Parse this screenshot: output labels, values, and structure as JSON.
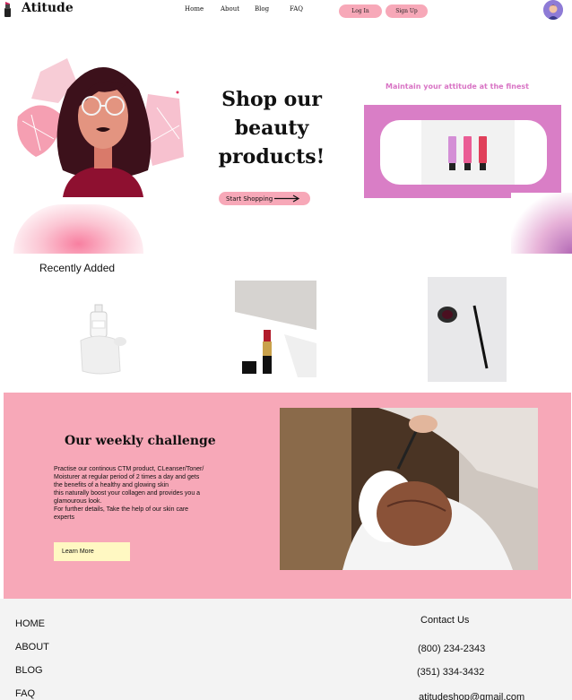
{
  "header": {
    "brand": "Atitude",
    "nav": [
      "Home",
      "About",
      "Blog",
      "FAQ"
    ],
    "login_label": "Log In",
    "signup_label": "Sign Up"
  },
  "hero": {
    "title_line1": "Shop our",
    "title_line2": "beauty",
    "title_line3": "products!",
    "cta_label": "Start Shopping",
    "tagline": "Maintain your attitude at the finest"
  },
  "recent": {
    "title": "Recently Added"
  },
  "challenge": {
    "title": "Our weekly challenge",
    "body_line1": "Practise our continous CTM product, CLeanser/Toner/",
    "body_line2": "Moisturer at regular period of 2 times a day and gets",
    "body_line3": "the benefits of a healthy and glowing skin",
    "body_line4": "this naturally boost your collagen and provides you a",
    "body_line5": "glamourous look.",
    "body_line6": "For further details, Take the help of our skin care",
    "body_line7": "experts",
    "button_label": "Learn More"
  },
  "footer": {
    "links": [
      "HOME",
      "ABOUT",
      "BLOG",
      "FAQ"
    ],
    "contact_title": "Contact Us",
    "phone1": "(800) 234-2343",
    "phone2": "(351) 334-3432",
    "email": "atitudeshop@gmail.com"
  },
  "colors": {
    "pink": "#f7a8b8",
    "magenta": "#d97ec6",
    "tagline": "#d873c4",
    "learn_button": "#fff8c2",
    "footer_bg": "#f3f3f3"
  }
}
